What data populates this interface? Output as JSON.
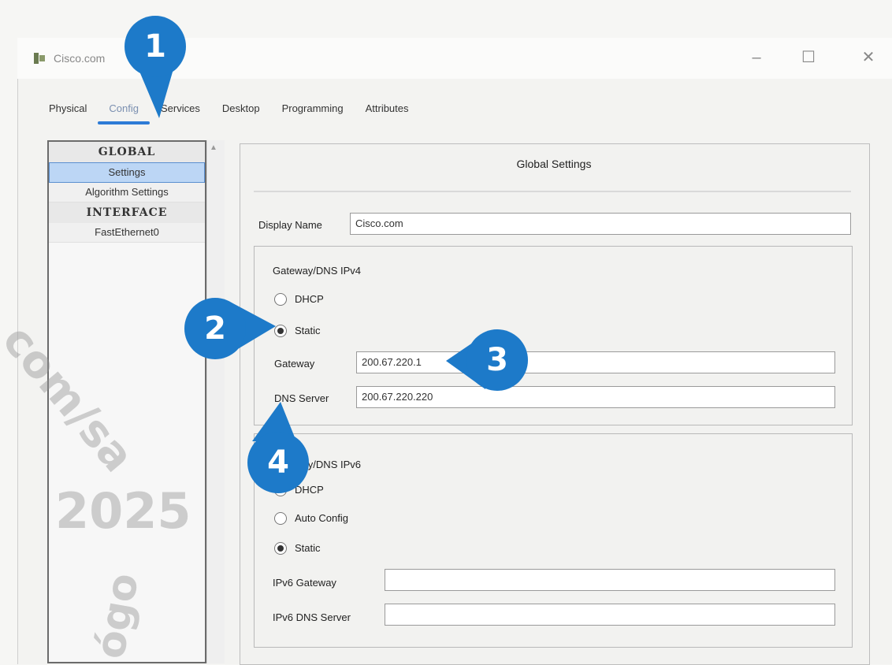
{
  "window": {
    "title": "Cisco.com",
    "minimize_glyph": "–",
    "maximize_glyph": "☐",
    "close_glyph": "✕"
  },
  "tabs": [
    {
      "label": "Physical"
    },
    {
      "label": "Config"
    },
    {
      "label": "Services"
    },
    {
      "label": "Desktop"
    },
    {
      "label": "Programming"
    },
    {
      "label": "Attributes"
    }
  ],
  "sidebar": {
    "global_header": "GLOBAL",
    "global_items": [
      "Settings",
      "Algorithm Settings"
    ],
    "interface_header": "INTERFACE",
    "interface_items": [
      "FastEthernet0"
    ]
  },
  "global_settings": {
    "title": "Global Settings",
    "display_name_label": "Display Name",
    "display_name_value": "Cisco.com",
    "ipv4": {
      "title": "Gateway/DNS IPv4",
      "dhcp_label": "DHCP",
      "static_label": "Static",
      "mode": "static",
      "gateway_label": "Gateway",
      "gateway_value": "200.67.220.1",
      "dns_label": "DNS Server",
      "dns_value": "200.67.220.220"
    },
    "ipv6": {
      "title": "Gateway/DNS IPv6",
      "dhcp_label": "DHCP",
      "auto_label": "Auto Config",
      "static_label": "Static",
      "mode": "static",
      "gateway_label": "IPv6 Gateway",
      "gateway_value": "",
      "dns_label": "IPv6 DNS Server",
      "dns_value": ""
    }
  },
  "callouts": [
    "1",
    "2",
    "3",
    "4"
  ],
  "watermark": {
    "line1": "com/sa",
    "line2": "2025",
    "line3": "ógo"
  },
  "colors": {
    "accent": "#1d7ac9",
    "selected_bg": "#bcd6f5"
  }
}
